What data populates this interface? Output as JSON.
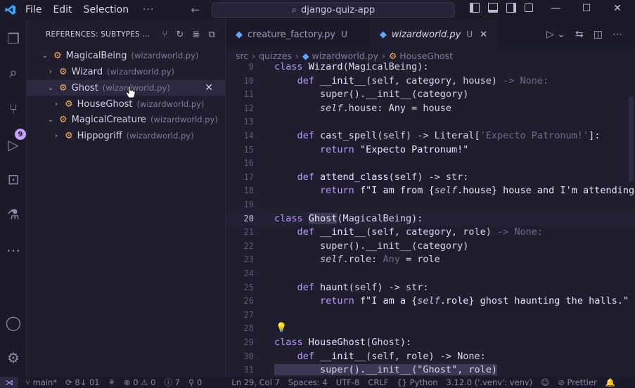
{
  "titlebar": {
    "menus": [
      "File",
      "Edit",
      "Selection"
    ],
    "more": "···",
    "search_text": "django-quiz-app"
  },
  "activity": {
    "badge": "9"
  },
  "sidebar": {
    "header": "REFERENCES: SUBTYPES ...",
    "items": [
      {
        "label": "MagicalBeing",
        "file": "(wizardworld.py)",
        "chev": "⌄"
      },
      {
        "label": "Wizard",
        "file": "(wizardworld.py)",
        "chev": "›"
      },
      {
        "label": "Ghost",
        "file": "(wizardworld.py)",
        "chev": "⌄"
      },
      {
        "label": "HouseGhost",
        "file": "(wizardworld.py)",
        "chev": "›"
      },
      {
        "label": "MagicalCreature",
        "file": "(wizardworld.py)",
        "chev": "⌄"
      },
      {
        "label": "Hippogriff",
        "file": "(wizardworld.py)",
        "chev": "›"
      }
    ]
  },
  "tabs": [
    {
      "label": "creature_factory.py",
      "status": "U"
    },
    {
      "label": "wizardworld.py",
      "status": "U"
    }
  ],
  "breadcrumb": [
    "src",
    "quizzes",
    "wizardworld.py",
    "HouseGhost"
  ],
  "editor": {
    "lines": [
      {
        "n": "9"
      },
      {
        "n": "10"
      },
      {
        "n": "11"
      },
      {
        "n": "12"
      },
      {
        "n": "13"
      },
      {
        "n": "14"
      },
      {
        "n": "15"
      },
      {
        "n": "16"
      },
      {
        "n": "17"
      },
      {
        "n": "18"
      },
      {
        "n": "19"
      },
      {
        "n": "20"
      },
      {
        "n": "21"
      },
      {
        "n": "22"
      },
      {
        "n": "23"
      },
      {
        "n": "24"
      },
      {
        "n": "25"
      },
      {
        "n": "26"
      },
      {
        "n": "27"
      },
      {
        "n": "28"
      },
      {
        "n": "29"
      },
      {
        "n": "30"
      },
      {
        "n": "31"
      }
    ]
  },
  "statusbar": {
    "branch": "main*",
    "sync": "8↓ 01",
    "problems": "⊗ 0 ⚠ 0",
    "info": "7",
    "ports": "0",
    "cursor": "Ln 29, Col 7",
    "spaces": "Spaces: 4",
    "encoding": "UTF-8",
    "eol": "CRLF",
    "language": "Python",
    "interpreter": "3.12.0 ('.venv': venv)",
    "formatter": "Prettier"
  }
}
